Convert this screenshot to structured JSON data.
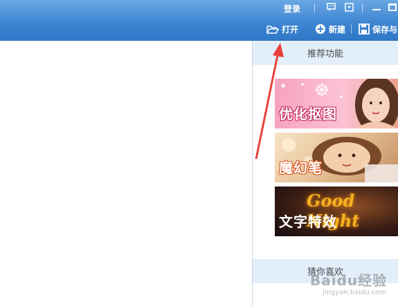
{
  "header": {
    "login_label": "登录",
    "toolbar": {
      "open_label": "打开",
      "new_label": "新建",
      "save_label": "保存与"
    }
  },
  "panel": {
    "recommended_title": "推荐功能",
    "features": [
      {
        "label": "优化抠图"
      },
      {
        "label": "魔幻笔"
      },
      {
        "label": "文字特效",
        "script_text": "Good Night"
      }
    ],
    "guess_title": "猜你喜欢"
  },
  "watermark": {
    "brand": "Baidu经验",
    "url": "jingyan.baidu.com"
  },
  "colors": {
    "topbar": "#3f86d2",
    "panel_header": "#e3eefb",
    "annotation_arrow": "#e8403a"
  },
  "icons": {
    "open": "folder-open-icon",
    "new": "plus-circle-icon",
    "save": "floppy-disk-icon",
    "feedback": "speech-bubble-icon",
    "menu": "dropdown-menu-icon",
    "minimize": "minimize-icon",
    "maximize": "maximize-icon"
  }
}
